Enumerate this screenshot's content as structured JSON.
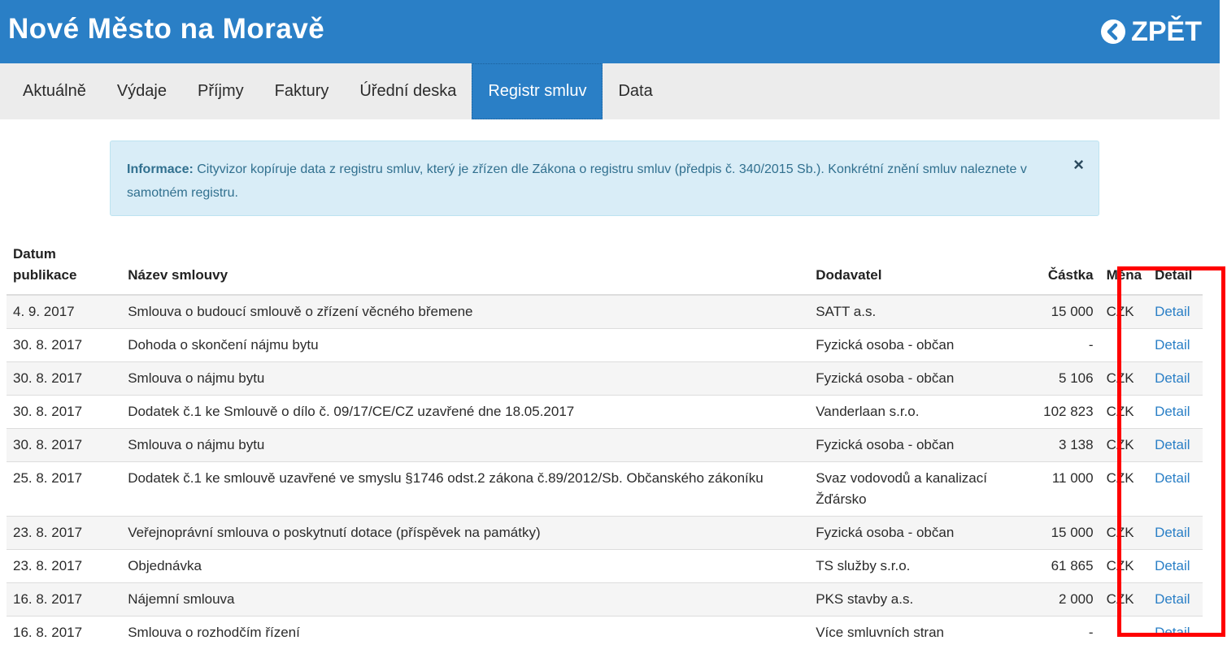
{
  "header": {
    "title": "Nové Město na Moravě",
    "back_label": "ZPĚT"
  },
  "nav": {
    "items": [
      {
        "label": "Aktuálně"
      },
      {
        "label": "Výdaje"
      },
      {
        "label": "Příjmy"
      },
      {
        "label": "Faktury"
      },
      {
        "label": "Úřední deska"
      },
      {
        "label": "Registr smluv",
        "active": true
      },
      {
        "label": "Data"
      }
    ]
  },
  "alert": {
    "strong": "Informace:",
    "text": " Cityvizor kopíruje data z registru smluv, který je zřízen dle Zákona o registru smluv (předpis č. 340/2015 Sb.). Konkrétní znění smluv naleznete v samotném registru.",
    "close": "×"
  },
  "table": {
    "headers": {
      "date_line1": "Datum",
      "date_line2": "publikace",
      "name": "Název smlouvy",
      "supplier": "Dodavatel",
      "amount": "Částka",
      "currency": "Měna",
      "detail": "Detail"
    },
    "rows": [
      {
        "date": "4. 9. 2017",
        "name": "Smlouva o budoucí smlouvě o zřízení věcného břemene",
        "supplier": "SATT a.s.",
        "amount": "15 000",
        "currency": "CZK",
        "detail": "Detail"
      },
      {
        "date": "30. 8. 2017",
        "name": "Dohoda o skončení nájmu bytu",
        "supplier": "Fyzická osoba - občan",
        "amount": "-",
        "currency": "",
        "detail": "Detail"
      },
      {
        "date": "30. 8. 2017",
        "name": "Smlouva o nájmu bytu",
        "supplier": "Fyzická osoba - občan",
        "amount": "5 106",
        "currency": "CZK",
        "detail": "Detail"
      },
      {
        "date": "30. 8. 2017",
        "name": "Dodatek č.1 ke Smlouvě o dílo č. 09/17/CE/CZ uzavřené dne 18.05.2017",
        "supplier": "Vanderlaan s.r.o.",
        "amount": "102 823",
        "currency": "CZK",
        "detail": "Detail"
      },
      {
        "date": "30. 8. 2017",
        "name": "Smlouva o nájmu bytu",
        "supplier": "Fyzická osoba - občan",
        "amount": "3 138",
        "currency": "CZK",
        "detail": "Detail"
      },
      {
        "date": "25. 8. 2017",
        "name": "Dodatek č.1 ke smlouvě uzavřené ve smyslu §1746 odst.2 zákona č.89/2012/Sb. Občanského zákoníku",
        "supplier": "Svaz vodovodů a kanalizací Žďársko",
        "amount": "11 000",
        "currency": "CZK",
        "detail": "Detail"
      },
      {
        "date": "23. 8. 2017",
        "name": "Veřejnoprávní smlouva o poskytnutí dotace (příspěvek na památky)",
        "supplier": "Fyzická osoba - občan",
        "amount": "15 000",
        "currency": "CZK",
        "detail": "Detail"
      },
      {
        "date": "23. 8. 2017",
        "name": "Objednávka",
        "supplier": "TS služby s.r.o.",
        "amount": "61 865",
        "currency": "CZK",
        "detail": "Detail"
      },
      {
        "date": "16. 8. 2017",
        "name": "Nájemní smlouva",
        "supplier": "PKS stavby a.s.",
        "amount": "2 000",
        "currency": "CZK",
        "detail": "Detail"
      },
      {
        "date": "16. 8. 2017",
        "name": "Smlouva o rozhodčím řízení",
        "supplier": "Více smluvních stran",
        "amount": "-",
        "currency": "",
        "detail": "Detail"
      }
    ]
  },
  "colors": {
    "brand": "#2a7fc6",
    "alert_bg": "#d9edf7",
    "highlight": "#ff0000"
  }
}
